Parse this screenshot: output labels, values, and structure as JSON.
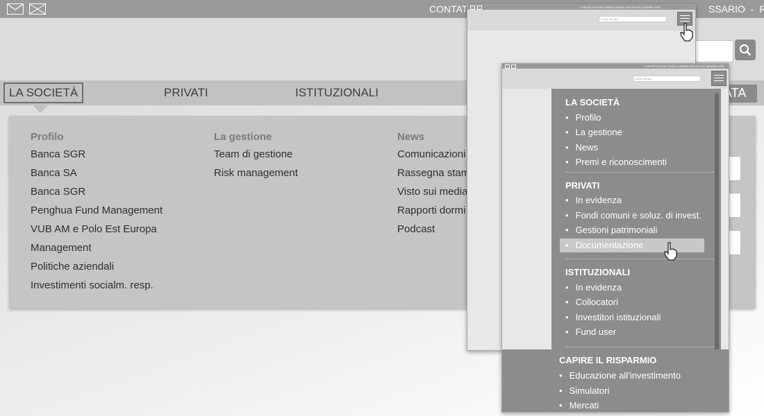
{
  "topbar": {
    "links": "CONTATTI",
    "links_right": "SSARIO  -  RSS"
  },
  "nav": {
    "items": [
      {
        "label": "LA SOCIETÀ"
      },
      {
        "label": "PRIVATI"
      },
      {
        "label": "ISTITUZIONALI"
      },
      {
        "label": "ATA"
      }
    ]
  },
  "mega": {
    "columns": [
      {
        "heading": "Profilo",
        "items": [
          "Banca SGR",
          "Banca SA",
          "Banca SGR",
          "Penghua Fund Management",
          "VUB AM e Polo Est Europa",
          "Management",
          "Politiche aziendali",
          "Investimenti socialm. resp."
        ]
      },
      {
        "heading": "La gestione",
        "items": [
          "Team di gestione",
          "Risk management"
        ]
      },
      {
        "heading": "News",
        "items": [
          "Comunicazioni",
          "Rassegna stamp",
          "Visto sui media",
          "Rapporti dormi",
          "Podcast"
        ]
      }
    ]
  },
  "mini": {
    "links": "CONTATTI   DOVE SIAMO   LAVORA CON NOI   GLOSSARIO   RSS",
    "search_placeholder": "Cerca nel sito"
  },
  "mobile_menu": {
    "sections": [
      {
        "title": "LA SOCIETÀ",
        "items": [
          "Profilo",
          "La gestione",
          "News",
          "Premi e riconoscimenti"
        ]
      },
      {
        "title": "PRIVATI",
        "items": [
          "In evidenza",
          "Fondi comuni e soluz. di invest.",
          "Gestioni patrimoniali",
          "Documentazione"
        ]
      },
      {
        "title": "ISTITUZIONALI",
        "items": [
          "In evidenza",
          "Collocatori",
          "Investitori istituzionali",
          "Fund user"
        ]
      },
      {
        "title": "CAPIRE IL RISPARMIO",
        "items": [
          "Educazione all’investimento",
          "Simulatori",
          "Mercati"
        ]
      }
    ],
    "highlighted": "Documentazione"
  },
  "colors": {
    "topbar": "#9a9a9a",
    "nav": "#c2c2c2",
    "panel": "#8c8c8c",
    "highlight": "#c8c8c8"
  }
}
